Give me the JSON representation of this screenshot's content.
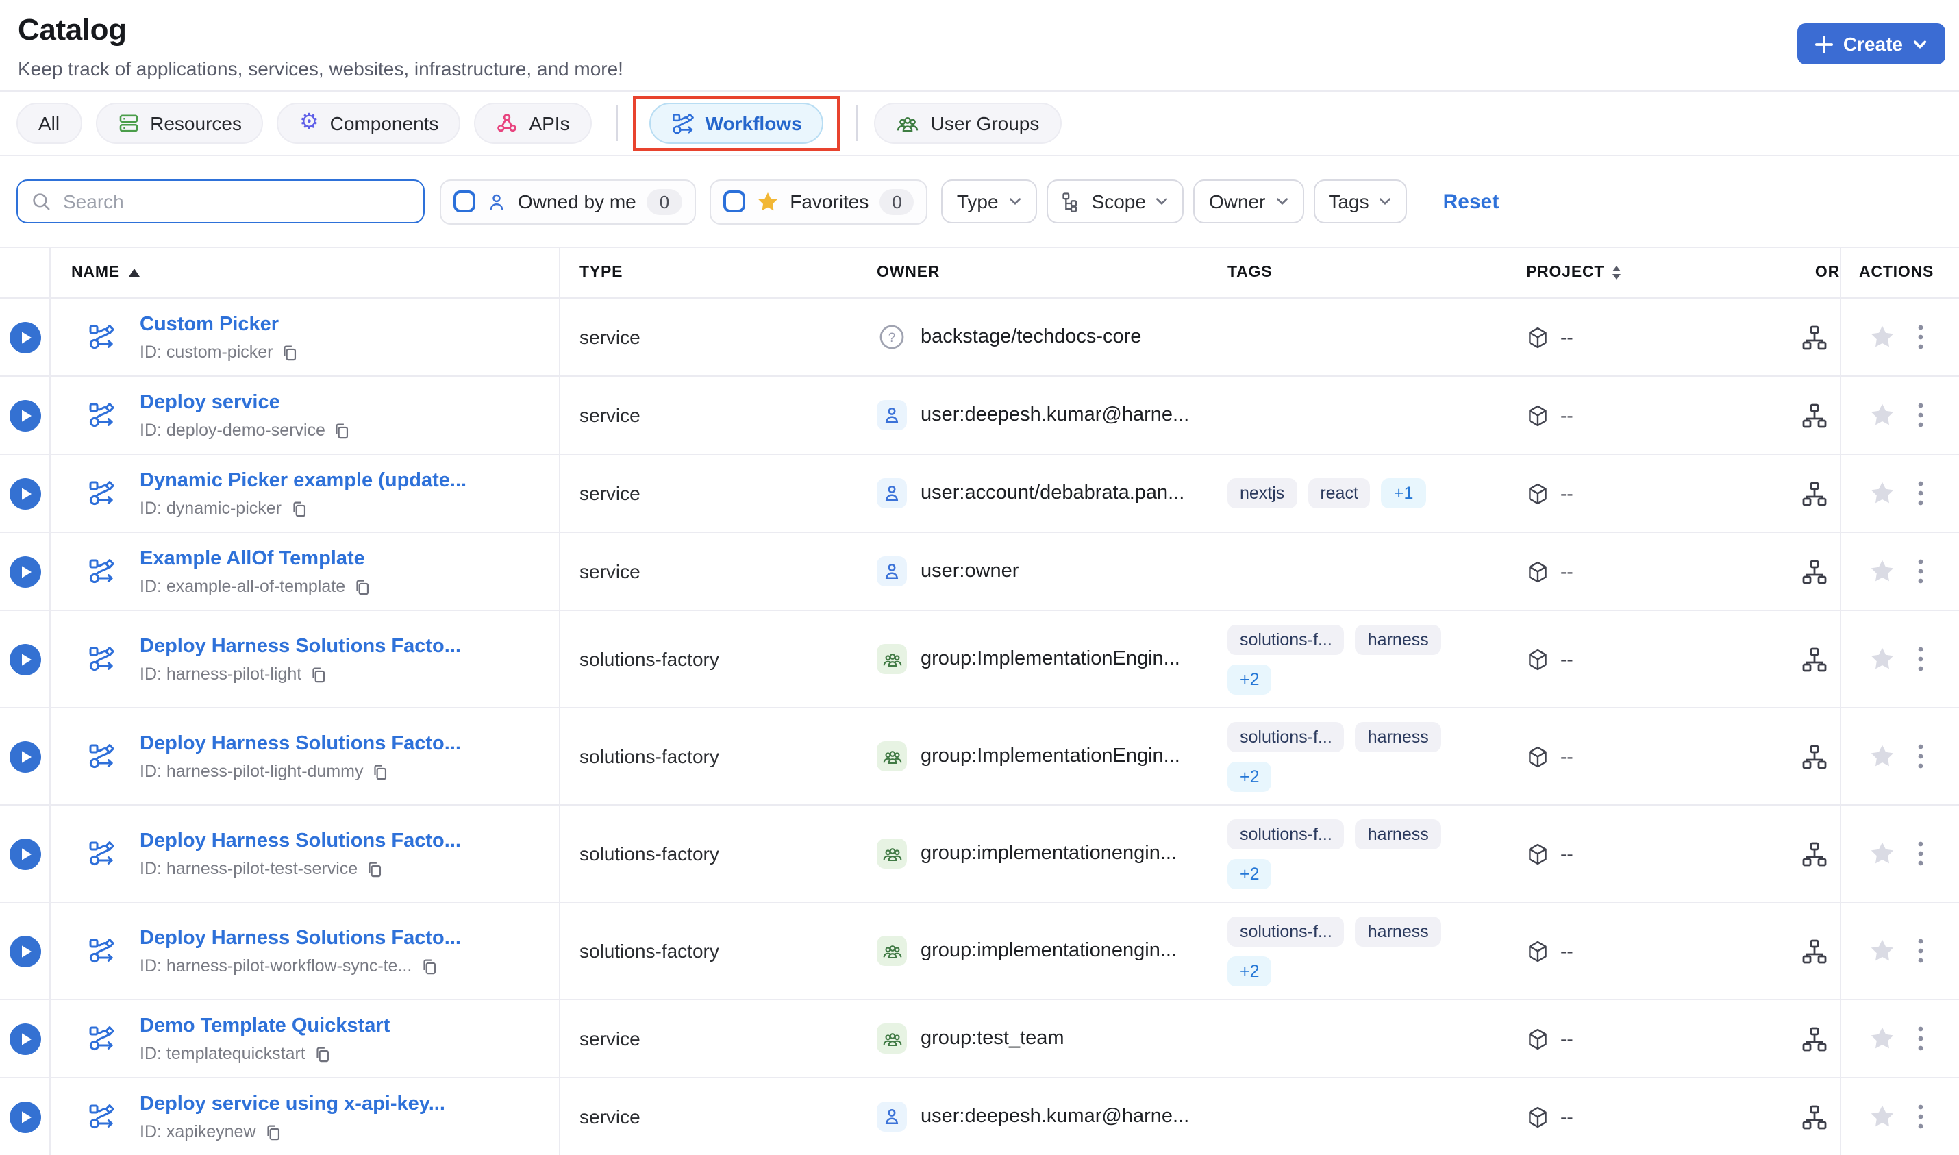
{
  "page": {
    "title": "Catalog",
    "subtitle": "Keep track of applications, services, websites, infrastructure, and more!"
  },
  "create_button": {
    "label": "Create"
  },
  "tabs": [
    {
      "label": "All",
      "icon": "none",
      "active": false
    },
    {
      "label": "Resources",
      "icon": "resources-stack-icon",
      "active": false
    },
    {
      "label": "Components",
      "icon": "gear-icon",
      "active": false
    },
    {
      "label": "APIs",
      "icon": "api-network-icon",
      "active": false
    },
    {
      "label": "Workflows",
      "icon": "workflow-icon",
      "active": true,
      "highlighted_by_red_box": true
    },
    {
      "label": "User Groups",
      "icon": "user-groups-icon",
      "active": false
    }
  ],
  "filters": {
    "search_placeholder": "Search",
    "owned_by_me": {
      "label": "Owned by me",
      "count": "0"
    },
    "favorites": {
      "label": "Favorites",
      "count": "0"
    },
    "dropdowns": [
      {
        "label": "Type",
        "icon": "none"
      },
      {
        "label": "Scope",
        "icon": "scope-tree-icon"
      },
      {
        "label": "Owner",
        "icon": "none"
      },
      {
        "label": "Tags",
        "icon": "none"
      }
    ],
    "reset_label": "Reset"
  },
  "table": {
    "columns": [
      {
        "label": "NAME",
        "sort": "asc"
      },
      {
        "label": "TYPE",
        "sort": "none"
      },
      {
        "label": "OWNER",
        "sort": "none"
      },
      {
        "label": "TAGS",
        "sort": "none"
      },
      {
        "label": "PROJECT",
        "sort": "both"
      },
      {
        "label": "OR",
        "sort": "none",
        "note": "truncated by column edge"
      },
      {
        "label": "ACTIONS",
        "sort": "none"
      }
    ],
    "rows": [
      {
        "name": "Custom Picker",
        "id_label": "ID: custom-picker",
        "type": "service",
        "owner": {
          "kind": "unknown",
          "label": "backstage/techdocs-core"
        },
        "tags": [],
        "project": "--"
      },
      {
        "name": "Deploy service",
        "id_label": "ID: deploy-demo-service",
        "type": "service",
        "owner": {
          "kind": "user",
          "label": "user:deepesh.kumar@harne..."
        },
        "tags": [],
        "project": "--"
      },
      {
        "name": "Dynamic Picker example (update...",
        "id_label": "ID: dynamic-picker",
        "type": "service",
        "owner": {
          "kind": "user",
          "label": "user:account/debabrata.pan..."
        },
        "tags": [
          "nextjs",
          "react"
        ],
        "more_tag": "+1",
        "tags_wrapped": false,
        "project": "--"
      },
      {
        "name": "Example AllOf Template",
        "id_label": "ID: example-all-of-template",
        "type": "service",
        "owner": {
          "kind": "user",
          "label": "user:owner"
        },
        "tags": [],
        "project": "--"
      },
      {
        "name": "Deploy Harness Solutions Facto...",
        "id_label": "ID: harness-pilot-light",
        "type": "solutions-factory",
        "owner": {
          "kind": "group",
          "label": "group:ImplementationEngin..."
        },
        "tags": [
          "solutions-f...",
          "harness"
        ],
        "more_tag": "+2",
        "tags_wrapped": true,
        "project": "--"
      },
      {
        "name": "Deploy Harness Solutions Facto...",
        "id_label": "ID: harness-pilot-light-dummy",
        "type": "solutions-factory",
        "owner": {
          "kind": "group",
          "label": "group:ImplementationEngin..."
        },
        "tags": [
          "solutions-f...",
          "harness"
        ],
        "more_tag": "+2",
        "tags_wrapped": true,
        "project": "--"
      },
      {
        "name": "Deploy Harness Solutions Facto...",
        "id_label": "ID: harness-pilot-test-service",
        "type": "solutions-factory",
        "owner": {
          "kind": "group",
          "label": "group:implementationengin..."
        },
        "tags": [
          "solutions-f...",
          "harness"
        ],
        "more_tag": "+2",
        "tags_wrapped": true,
        "project": "--"
      },
      {
        "name": "Deploy Harness Solutions Facto...",
        "id_label": "ID: harness-pilot-workflow-sync-te...",
        "type": "solutions-factory",
        "owner": {
          "kind": "group",
          "label": "group:implementationengin..."
        },
        "tags": [
          "solutions-f...",
          "harness"
        ],
        "more_tag": "+2",
        "tags_wrapped": true,
        "project": "--"
      },
      {
        "name": "Demo Template Quickstart",
        "id_label": "ID: templatequickstart",
        "type": "service",
        "owner": {
          "kind": "group",
          "label": "group:test_team"
        },
        "tags": [],
        "project": "--"
      },
      {
        "name": "Deploy service using x-api-key...",
        "id_label": "ID: xapikeynew",
        "type": "service",
        "owner": {
          "kind": "user",
          "label": "user:deepesh.kumar@harne..."
        },
        "tags": [],
        "project": "--"
      }
    ]
  },
  "colors": {
    "accent": "#3b6cd3",
    "link": "#2e71d9",
    "annotation": "#e8432e",
    "workflows_pill_bg": "#eaf6fd",
    "tag_bg": "#f1f1f6",
    "more_tag_bg": "#e8f6fd",
    "group_icon_green": "#417a45",
    "favorites_star_gold": "#f2b735"
  }
}
